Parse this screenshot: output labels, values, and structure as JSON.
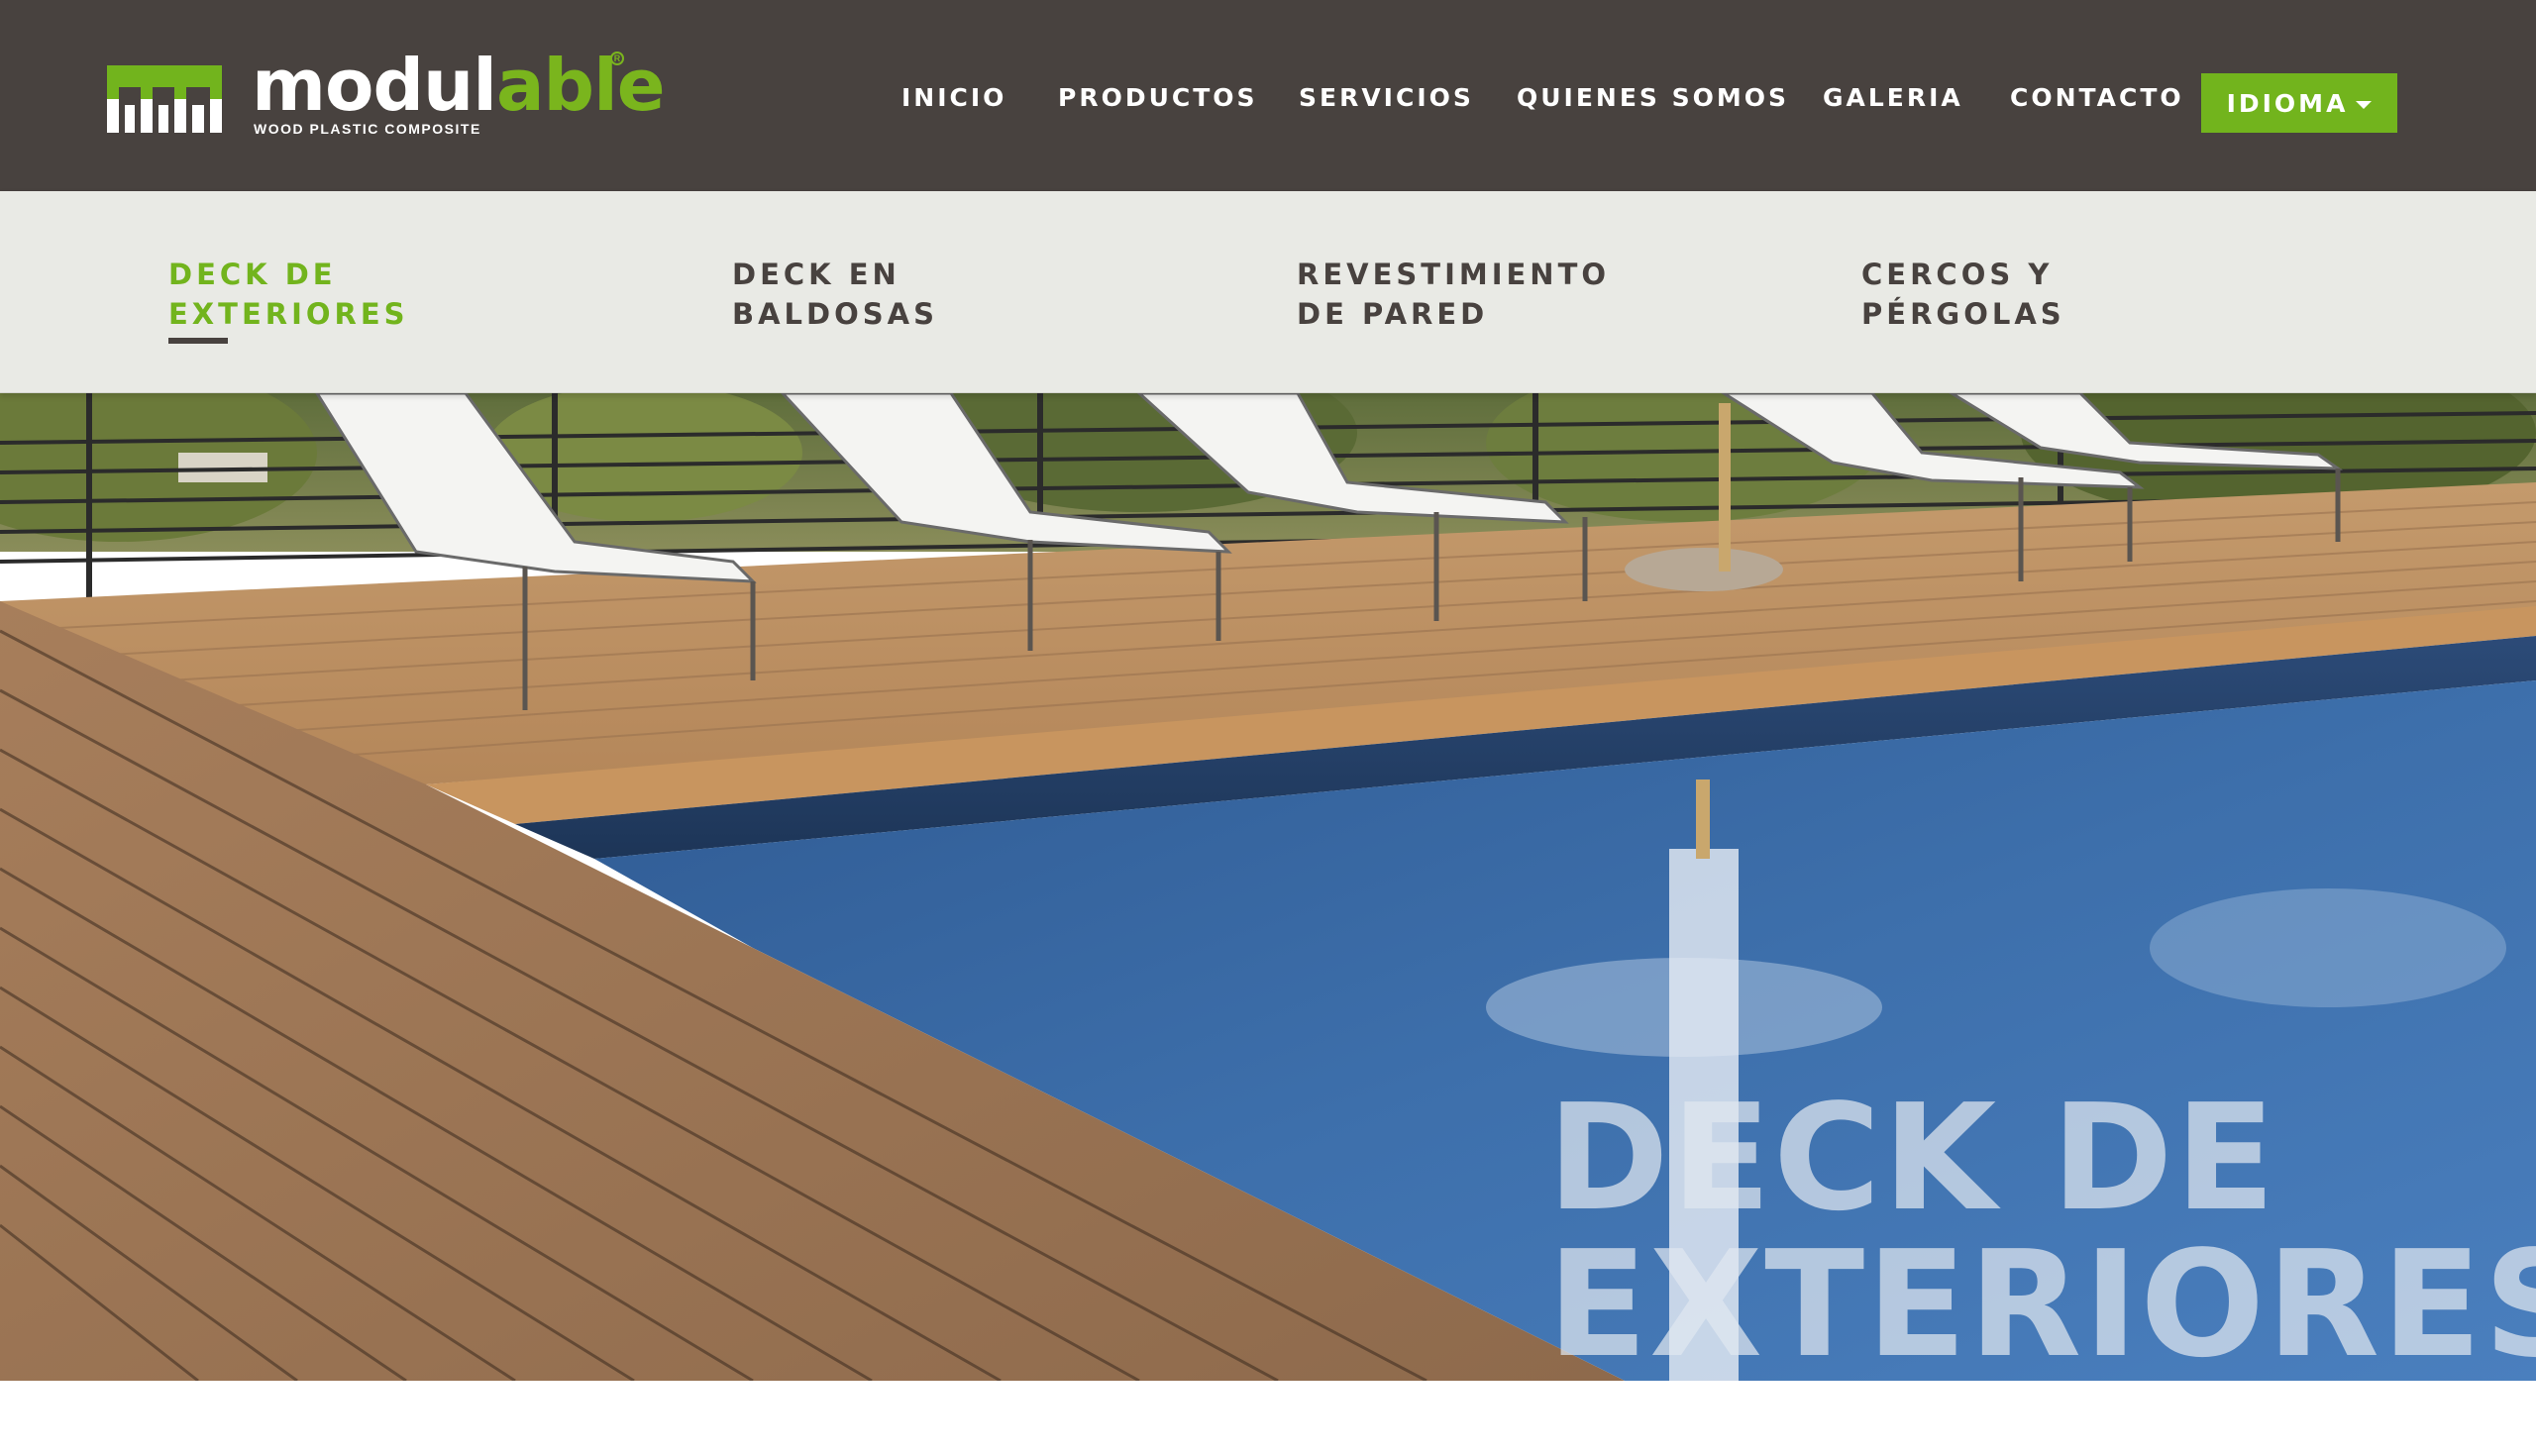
{
  "brand": {
    "name_part1": "modul",
    "name_part2": "able",
    "registered": "R",
    "tagline": "WOOD PLASTIC COMPOSITE"
  },
  "nav": {
    "items": [
      {
        "label": "INICIO"
      },
      {
        "label": "PRODUCTOS"
      },
      {
        "label": "SERVICIOS"
      },
      {
        "label": "QUIENES SOMOS"
      },
      {
        "label": "GALERIA"
      },
      {
        "label": "CONTACTO"
      }
    ],
    "language_button": "IDIOMA"
  },
  "subnav": {
    "items": [
      {
        "line1": "DECK DE",
        "line2": "EXTERIORES",
        "active": true
      },
      {
        "line1": "DECK EN",
        "line2": "BALDOSAS",
        "active": false
      },
      {
        "line1": "REVESTIMIENTO",
        "line2": "DE PARED",
        "active": false
      },
      {
        "line1": "CERCOS Y",
        "line2": "PÉRGOLAS",
        "active": false
      }
    ]
  },
  "hero": {
    "title_line1": "DECK DE",
    "title_line2": "EXTERIORES"
  },
  "colors": {
    "header_bg": "#48423f",
    "accent_green": "#72b41d",
    "subnav_bg": "#e9eae5",
    "text_dark": "#48423f"
  },
  "icons": {
    "logo": "modulable-logo-mark",
    "dropdown": "caret-down-icon"
  }
}
